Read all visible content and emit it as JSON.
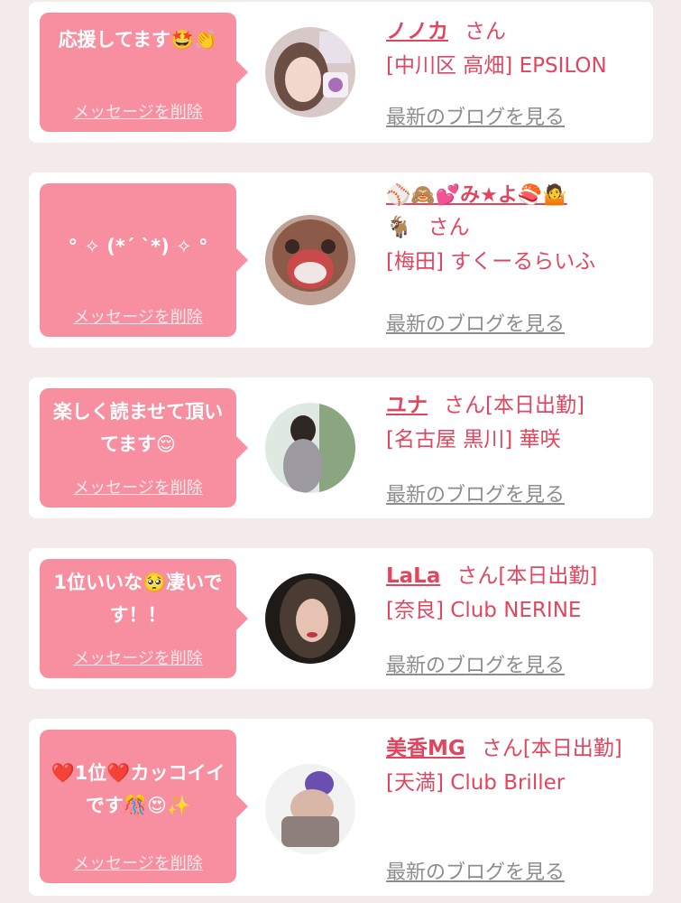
{
  "colors": {
    "bubble": "#f78fa0",
    "accent": "#e0475f",
    "link_gray": "#8d8d8d"
  },
  "cards": [
    {
      "message": "応援してます🤩👏",
      "delete_label": "メッセージを削除",
      "name": "ノノカ",
      "honorific": "さん",
      "status": "",
      "shop": "[中川区 高畑] EPSILON",
      "blog_label": "最新のブログを見る"
    },
    {
      "message": "° ✧ (*´ `*) ✧ °",
      "delete_label": "メッセージを削除",
      "name": "⚾🙈💕み★よ🍣🤷",
      "name_cont": "🐐",
      "honorific": "さん",
      "status": "",
      "shop": "[梅田] すくーるらいふ",
      "blog_label": "最新のブログを見る"
    },
    {
      "message": "楽しく読ませて頂いてます😌",
      "delete_label": "メッセージを削除",
      "name": "ユナ",
      "honorific": "さん",
      "status": "[本日出勤]",
      "shop": "[名古屋 黒川] 華咲",
      "blog_label": "最新のブログを見る"
    },
    {
      "message": "1位いいな🥺凄いです！！",
      "delete_label": "メッセージを削除",
      "name": "LaLa",
      "honorific": "さん",
      "status": "[本日出勤]",
      "shop": "[奈良] Club NERINE",
      "blog_label": "最新のブログを見る"
    },
    {
      "message": "❤️1位❤️カッコイイです🎊😍✨",
      "delete_label": "メッセージを削除",
      "name": "美香MG",
      "honorific": "さん",
      "status": "[本日出勤]",
      "shop": "[天満] Club Briller",
      "blog_label": "最新のブログを見る"
    }
  ]
}
